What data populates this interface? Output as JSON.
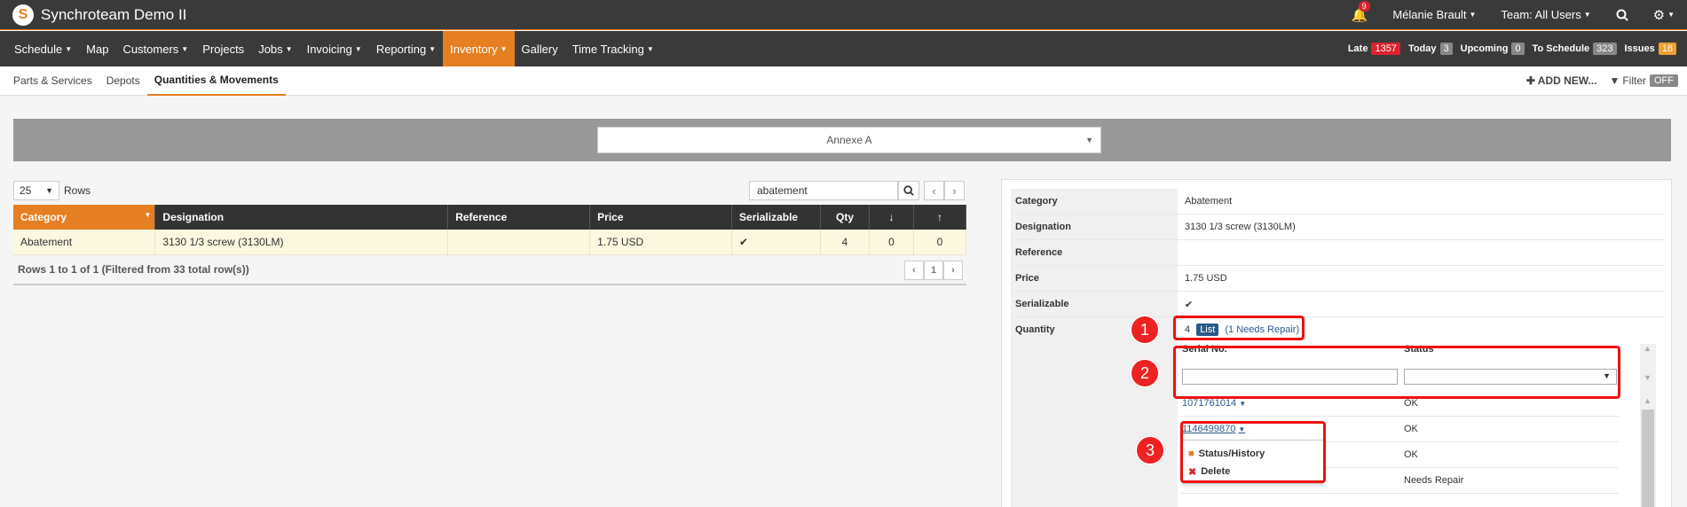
{
  "app": {
    "title": "Synchroteam Demo II",
    "logo_letter": "S"
  },
  "topbar": {
    "notifications": "9",
    "user": "Mélanie Brault",
    "team": "Team: All Users"
  },
  "nav": {
    "items": [
      "Schedule",
      "Map",
      "Customers",
      "Projects",
      "Jobs",
      "Invoicing",
      "Reporting",
      "Inventory",
      "Gallery",
      "Time Tracking"
    ],
    "stats": [
      {
        "label": "Late",
        "value": "1357"
      },
      {
        "label": "Today",
        "value": "3"
      },
      {
        "label": "Upcoming",
        "value": "0"
      },
      {
        "label": "To Schedule",
        "value": "323"
      },
      {
        "label": "Issues",
        "value": "18"
      }
    ]
  },
  "subnav": {
    "items": [
      "Parts & Services",
      "Depots",
      "Quantities & Movements"
    ],
    "add_new": "ADD NEW...",
    "filter": "Filter",
    "filter_state": "OFF"
  },
  "depot": {
    "selected": "Annexe A"
  },
  "table_controls": {
    "rows_value": "25",
    "rows_label": "Rows",
    "search_value": "abatement",
    "page": "1"
  },
  "table": {
    "headers": [
      "Category",
      "Designation",
      "Reference",
      "Price",
      "Serializable",
      "Qty",
      "↓",
      "↑"
    ],
    "row": {
      "category": "Abatement",
      "designation": "3130 1/3 screw (3130LM)",
      "reference": "",
      "price": "1.75 USD",
      "serializable": "✔",
      "qty": "4",
      "down": "0",
      "up": "0"
    },
    "footer": "Rows 1 to 1 of 1 (Filtered from 33 total row(s))"
  },
  "detail": {
    "labels": {
      "category": "Category",
      "designation": "Designation",
      "reference": "Reference",
      "price": "Price",
      "serializable": "Serializable",
      "quantity": "Quantity"
    },
    "values": {
      "category": "Abatement",
      "designation": "3130 1/3 screw (3130LM)",
      "reference": "",
      "price": "1.75 USD",
      "serializable": "✔",
      "quantity": "4",
      "list_badge": "List",
      "repair": "(1 Needs Repair)"
    }
  },
  "serials": {
    "col_serial": "Serial No.",
    "col_status": "Status",
    "rows": [
      {
        "serial": "1071761014",
        "status": "OK"
      },
      {
        "serial": "1146499870",
        "status": "OK"
      },
      {
        "serial": "",
        "status": "OK"
      },
      {
        "serial": "",
        "status": "Needs Repair"
      }
    ]
  },
  "context_menu": {
    "status_history": "Status/History",
    "delete": "Delete"
  },
  "callouts": [
    "1",
    "2",
    "3"
  ],
  "colors": {
    "accent": "#e67e22",
    "late": "#d9232e",
    "link": "#2a5a8c",
    "highlight": "#ee1111"
  }
}
